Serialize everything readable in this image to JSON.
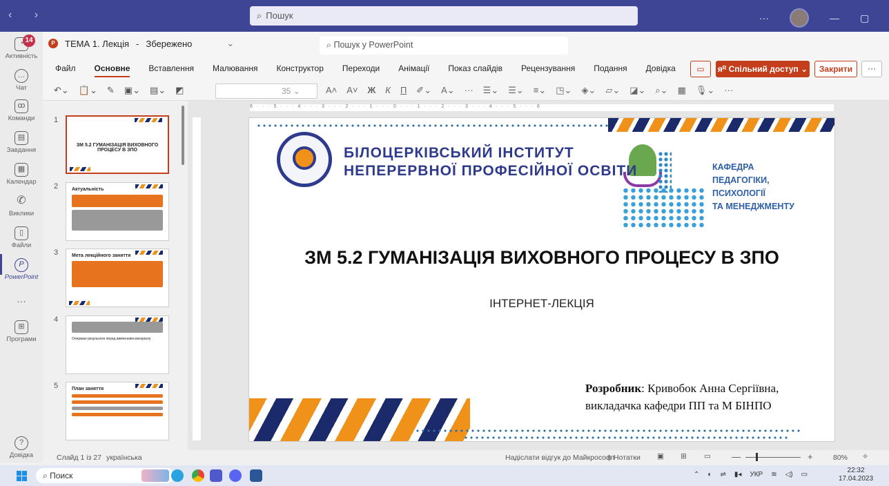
{
  "titlebar": {
    "nav": "‹ ›",
    "search_placeholder": "Пошук",
    "more": "···",
    "minimize": "—",
    "maximize": "▢",
    "close": "✕"
  },
  "rail": {
    "badge": "14",
    "items": [
      {
        "label": "Активність",
        "icon": "bell-icon"
      },
      {
        "label": "Чат",
        "icon": "chat-icon"
      },
      {
        "label": "Команди",
        "icon": "teams-icon"
      },
      {
        "label": "Завдання",
        "icon": "assignments-icon"
      },
      {
        "label": "Календар",
        "icon": "calendar-icon"
      },
      {
        "label": "Виклики",
        "icon": "phone-icon"
      },
      {
        "label": "Файли",
        "icon": "file-icon"
      },
      {
        "label": "PowerPoint",
        "icon": "powerpoint-icon"
      },
      {
        "label": "···",
        "icon": "more-icon"
      },
      {
        "label": "Програми",
        "icon": "apps-icon"
      },
      {
        "label": "Довідка",
        "icon": "help-icon"
      }
    ]
  },
  "document": {
    "title": "ТЕМА 1. Лекція",
    "saved": "Збережено",
    "ppt_search": "Пошук у PowerPoint"
  },
  "menu": [
    "Файл",
    "Основне",
    "Вставлення",
    "Малювання",
    "Конструктор",
    "Переходи",
    "Анімації",
    "Показ слайдів",
    "Рецензування",
    "Подання",
    "Довідка"
  ],
  "menu_active": "Основне",
  "actions": {
    "share": "ᴙᴿ Спільний доступ ⌄",
    "close": "Закрити",
    "more": "···"
  },
  "toolbar": {
    "font_size": "35",
    "bold": "Ж",
    "italic": "К",
    "underline": "П"
  },
  "thumbnails": [
    {
      "num": "1",
      "title": "ЗМ 5.2 ГУМАНІЗАЦІЯ ВИХОВНОГО ПРОЦЕСУ В ЗПО"
    },
    {
      "num": "2",
      "title": "Актуальність"
    },
    {
      "num": "3",
      "title": "Мета лекційного заняття"
    },
    {
      "num": "4",
      "title": "Очікувані результати перед вивченням матеріалу"
    },
    {
      "num": "5",
      "title": "План заняття"
    }
  ],
  "ruler": "6 · · · 5 · · · 4 · · · 3 · · · 2 · · · 1 · · · 0 · · · 1 · · · 2 · · · 3 · · · 4 · · · 5 · · · 6",
  "slide": {
    "institute_line1": "БІЛОЦЕРКІВСЬКИЙ ІНСТИТУТ",
    "institute_line2": "НЕПЕРЕРВНОЇ ПРОФЕСІЙНОЇ ОСВІТИ",
    "dept_lines": [
      "КАФЕДРА",
      "ПЕДАГОГІКИ,",
      "ПСИХОЛОГІЇ",
      "ТА МЕНЕДЖМЕНТУ"
    ],
    "title": "ЗМ 5.2 ГУМАНІЗАЦІЯ ВИХОВНОГО ПРОЦЕСУ В ЗПО",
    "subtitle": "ІНТЕРНЕТ-ЛЕКЦІЯ",
    "author_label": "Розробник",
    "author_name": ": Кривобок Анна Сергіївна,",
    "author_line2": "викладачка кафедри ПП та М БІНПО"
  },
  "status": {
    "slide": "Слайд 1 із 27",
    "language": "українська",
    "feedback": "Надіслати відгук до Майкрософт",
    "notes": "≡ Нотатки",
    "zoom": "80%"
  },
  "taskbar": {
    "search": "Поиск",
    "lang": "УКР",
    "time": "22:32",
    "date": "17.04.2023"
  },
  "colors": {
    "teams": "#3f4595",
    "ppt": "#c43e1c",
    "accent_orange": "#f0911a",
    "navy": "#1b2a6b"
  }
}
